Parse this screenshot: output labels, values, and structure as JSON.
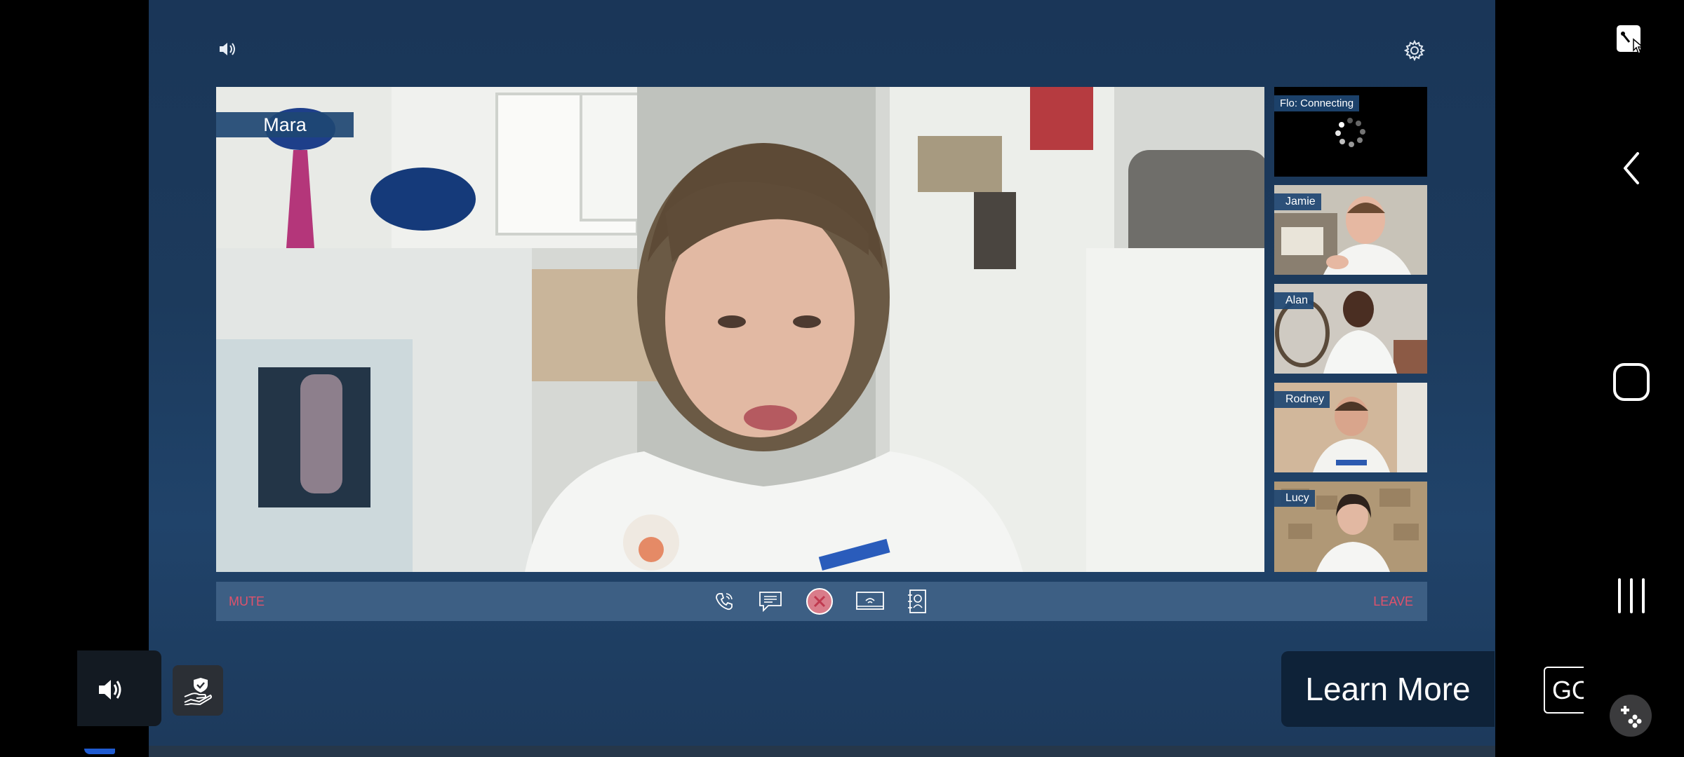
{
  "ad": {
    "main_participant": "Mara",
    "participants": [
      {
        "name": "Flo: Connecting",
        "status": "connecting"
      },
      {
        "name": "Jamie"
      },
      {
        "name": "Alan"
      },
      {
        "name": "Rodney"
      },
      {
        "name": "Lucy"
      }
    ],
    "controls": {
      "mute_label": "MUTE",
      "leave_label": "LEAVE",
      "center_icons": [
        "phone-icon",
        "chat-icon",
        "end-call-icon",
        "screen-share-icon",
        "contacts-icon"
      ]
    },
    "top_icons": [
      "speaker-icon",
      "settings-icon"
    ]
  },
  "overlay": {
    "learn_more_label": "Learn More",
    "go_label": "GO",
    "left_icons": [
      "volume-icon",
      "privacy-shield-icon"
    ]
  },
  "system_nav": {
    "icons": [
      "screenshot-icon",
      "back-icon",
      "home-icon",
      "recent-apps-icon",
      "game-tools-icon"
    ]
  },
  "colors": {
    "frame_bg": "#1c3a5c",
    "control_bar": "#3d5f84",
    "accent_red": "#e0526c",
    "name_tag": "#1e4673"
  }
}
